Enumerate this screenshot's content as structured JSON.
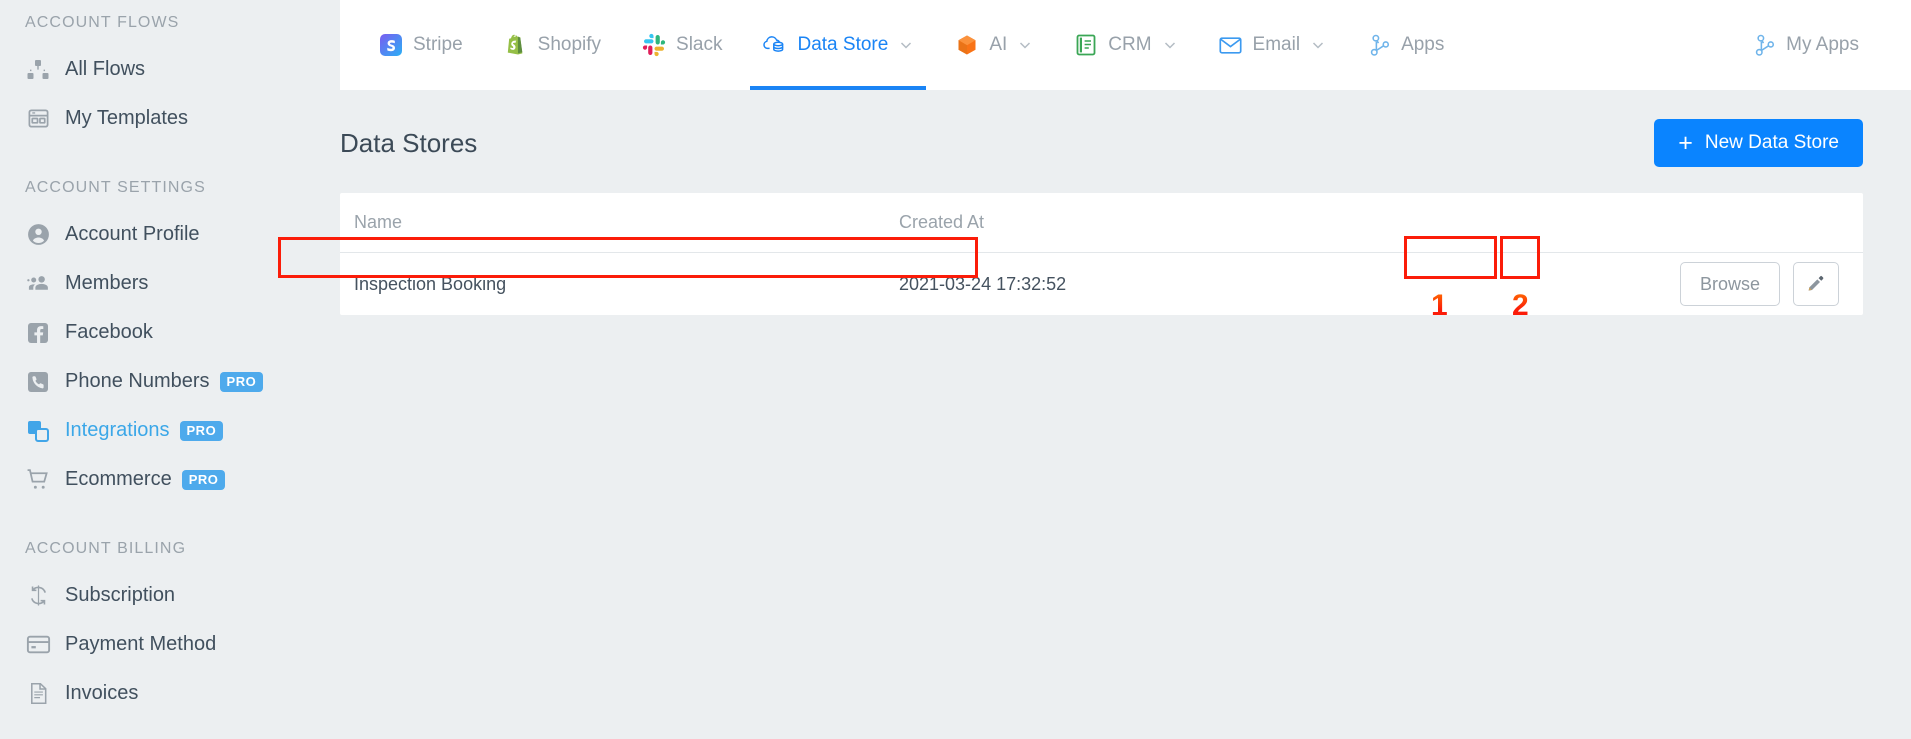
{
  "sidebar": {
    "sections": [
      {
        "title": "ACCOUNT FLOWS",
        "items": [
          {
            "label": "All Flows",
            "icon": "sitemap-icon",
            "active": false,
            "badge": ""
          },
          {
            "label": "My Templates",
            "icon": "template-icon",
            "active": false,
            "badge": ""
          }
        ]
      },
      {
        "title": "ACCOUNT SETTINGS",
        "items": [
          {
            "label": "Account Profile",
            "icon": "user-circle-icon",
            "active": false,
            "badge": ""
          },
          {
            "label": "Members",
            "icon": "users-icon",
            "active": false,
            "badge": ""
          },
          {
            "label": "Facebook",
            "icon": "facebook-icon",
            "active": false,
            "badge": ""
          },
          {
            "label": "Phone Numbers",
            "icon": "phone-icon",
            "active": false,
            "badge": "PRO"
          },
          {
            "label": "Integrations",
            "icon": "integrations-icon",
            "active": true,
            "badge": "PRO"
          },
          {
            "label": "Ecommerce",
            "icon": "cart-icon",
            "active": false,
            "badge": "PRO"
          }
        ]
      },
      {
        "title": "ACCOUNT BILLING",
        "items": [
          {
            "label": "Subscription",
            "icon": "refresh-icon",
            "active": false,
            "badge": ""
          },
          {
            "label": "Payment Method",
            "icon": "credit-card-icon",
            "active": false,
            "badge": ""
          },
          {
            "label": "Invoices",
            "icon": "invoice-icon",
            "active": false,
            "badge": ""
          }
        ]
      }
    ]
  },
  "topnav": {
    "tabs": [
      {
        "label": "Stripe",
        "icon": "stripe-icon",
        "caret": false,
        "active": false
      },
      {
        "label": "Shopify",
        "icon": "shopify-icon",
        "caret": false,
        "active": false
      },
      {
        "label": "Slack",
        "icon": "slack-icon",
        "caret": false,
        "active": false
      },
      {
        "label": "Data Store",
        "icon": "datastore-icon",
        "caret": true,
        "active": true
      },
      {
        "label": "AI",
        "icon": "ai-icon",
        "caret": true,
        "active": false
      },
      {
        "label": "CRM",
        "icon": "crm-icon",
        "caret": true,
        "active": false
      },
      {
        "label": "Email",
        "icon": "email-icon",
        "caret": true,
        "active": false
      },
      {
        "label": "Apps",
        "icon": "apps-icon",
        "caret": false,
        "active": false
      }
    ],
    "my_apps": {
      "label": "My Apps",
      "icon": "apps-icon"
    }
  },
  "page": {
    "title": "Data Stores",
    "new_button": {
      "label": "New Data Store",
      "plus": "+"
    }
  },
  "table": {
    "columns": [
      "Name",
      "Created At"
    ],
    "rows": [
      {
        "name": "Inspection Booking",
        "created_at": "2021-03-24 17:32:52",
        "browse_label": "Browse",
        "edit_icon": "pencil-icon"
      }
    ]
  },
  "annotations": {
    "markers": [
      {
        "number": "1",
        "target": "browse-button"
      },
      {
        "number": "2",
        "target": "edit-button"
      }
    ]
  },
  "colors": {
    "accent_blue": "#1a84f5",
    "primary_button": "#0a84ff",
    "pro_badge": "#4eaaec",
    "annotation_red": "#fb1c09",
    "sidebar_bg": "#eceff1"
  }
}
